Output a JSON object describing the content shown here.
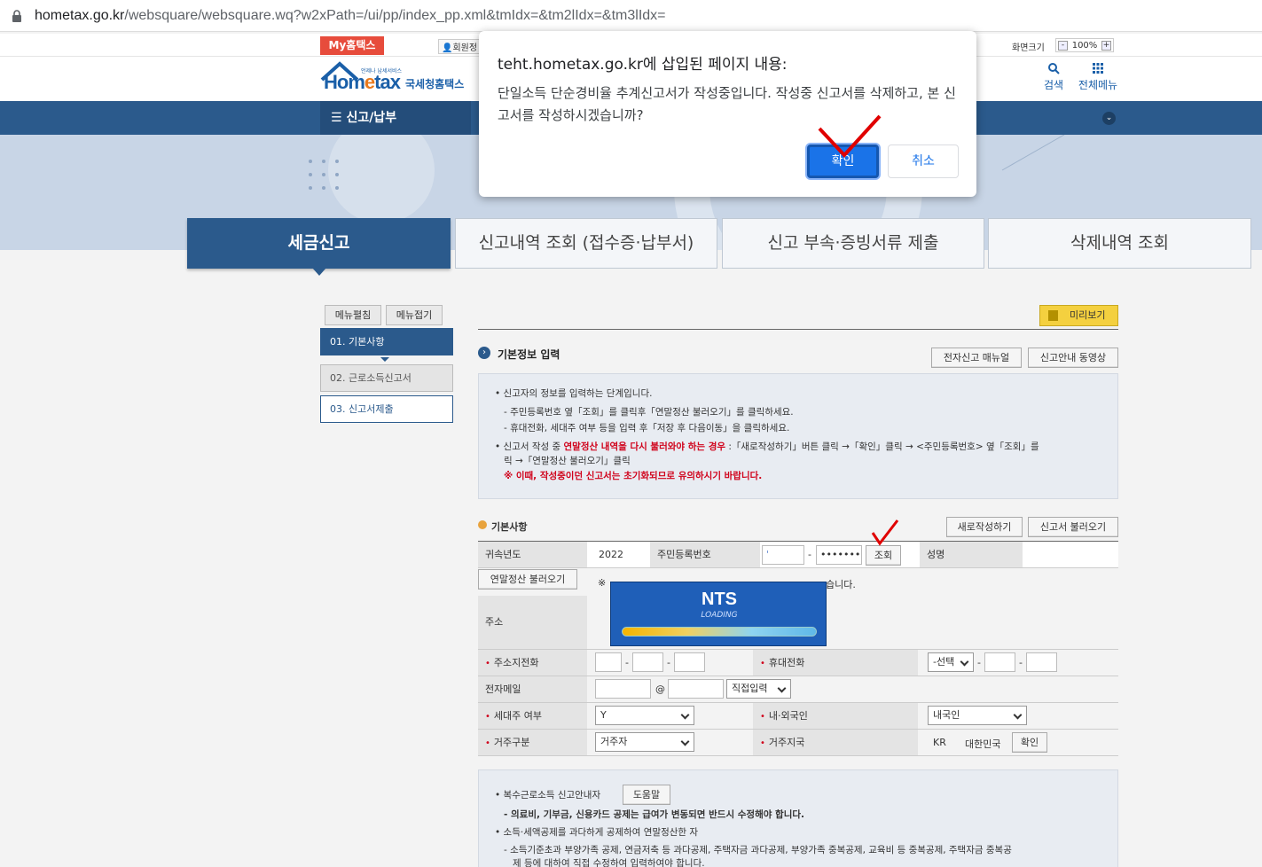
{
  "browser": {
    "url_host": "hometax.go.kr",
    "url_path": "/websquare/websquare.wq?w2xPath=/ui/pp/index_pp.xml&tmIdx=&tm2lIdx=&tm3lIdx="
  },
  "topbar": {
    "my_hometax": "My홈택스",
    "member_info": "회원정",
    "zoom_label": "화면크기",
    "zoom_value": "100%",
    "zoom_minus": "-",
    "zoom_plus": "+"
  },
  "header": {
    "logo_home": "Hom",
    "logo_e": "e",
    "logo_tax": "tax",
    "logo_kor": "국세청홈택스",
    "logo_sub": "언제나 납세서비스",
    "search": "검색",
    "all_menu": "전체메뉴"
  },
  "nav": {
    "menu": "신고/납부"
  },
  "tabs": [
    {
      "label": "세금신고",
      "active": true
    },
    {
      "label": "신고내역 조회 (접수증·납부서)"
    },
    {
      "label": "신고 부속·증빙서류 제출"
    },
    {
      "label": "삭제내역 조회"
    }
  ],
  "sidebar": {
    "edit": "메뉴펼침",
    "fold": "메뉴접기",
    "steps": [
      "01. 기본사항",
      "02. 근로소득신고서",
      "03. 신고서제출"
    ]
  },
  "content": {
    "preview": "미리보기",
    "section_title": "기본정보 입력",
    "manual_btn": "전자신고 매뉴얼",
    "video_btn": "신고안내 동영상",
    "info": [
      "신고자의 정보를 입력하는 단계입니다.",
      "- 주민등록번호 옆「조회」를 클릭후「연말정산 불러오기」를 클릭하세요.",
      "- 휴대전화, 세대주 여부 등을 입력 후「저장 후 다음이동」을 클릭하세요.",
      "신고서 작성 중",
      "연말정산 내역을 다시 불러와야 하는 경우",
      " :「새로작성하기」버튼 클릭 →「확인」클릭 → <주민등록번호> 옆「조회」를",
      "릭 →「연말정산 불러오기」클릭",
      "※ 이때, 작성중이던 신고서는 초기화되므로 유의하시기 바랍니다."
    ],
    "basic_title": "기본사항",
    "new_btn": "새로작성하기",
    "load_btn": "신고서 불러오기",
    "form": {
      "year_label": "귀속년도",
      "year_value": "2022",
      "rrn_label": "주민등록번호",
      "rrn_front": "' ",
      "rrn_back": "•••••••",
      "rrn_search": "조회",
      "name_label": "성명",
      "yearend_btn": "연말정산 불러오기",
      "notice_prefix": "※",
      "notice_suffix": "습니다.",
      "addr_label": "주소",
      "home_phone_label": "주소지전화",
      "mobile_label": "휴대전화",
      "mobile_select": "-선택",
      "email_label": "전자메일",
      "email_at": "@",
      "email_select": "직접입력",
      "head_label": "세대주 여부",
      "head_value": "Y",
      "nation_label": "내·외국인",
      "nation_value": "내국인",
      "residence_label": "거주구분",
      "residence_value": "거주자",
      "region_label": "거주지국",
      "region_code": "KR",
      "region_name": "대한민국",
      "region_btn": "확인"
    },
    "bottom": {
      "l1": "복수근로소득 신고안내자",
      "help": "도움말",
      "l2": "- 의료비, 기부금, 신용카드 공제는 급여가 변동되면 반드시 수정해야 합니다.",
      "l3": "소득·세액공제를 과다하게 공제하여 연말정산한 자",
      "l4": "- 소득기준초과 부양가족 공제, 연금저축 등 과다공제, 주택자금 과다공제, 부양가족 중복공제, 교육비 등 중복공제, 주택자금 중복공",
      "l5": "제 등에 대하여 직접 수정하여 입력하여야 합니다."
    }
  },
  "dialog": {
    "title": "teht.hometax.go.kr에 삽입된 페이지 내용:",
    "message": "단일소득 단순경비율 추계신고서가 작성중입니다. 작성중 신고서를 삭제하고, 본 신고서를 작성하시겠습니까?",
    "ok": "확인",
    "cancel": "취소"
  },
  "loading": {
    "title": "NTS",
    "subtitle": "LOADING"
  },
  "colors": {
    "nav": "#2b5a8c",
    "accent_red": "#d0021b",
    "dialog_button": "#1a73e8",
    "check_mark": "#e00000"
  }
}
